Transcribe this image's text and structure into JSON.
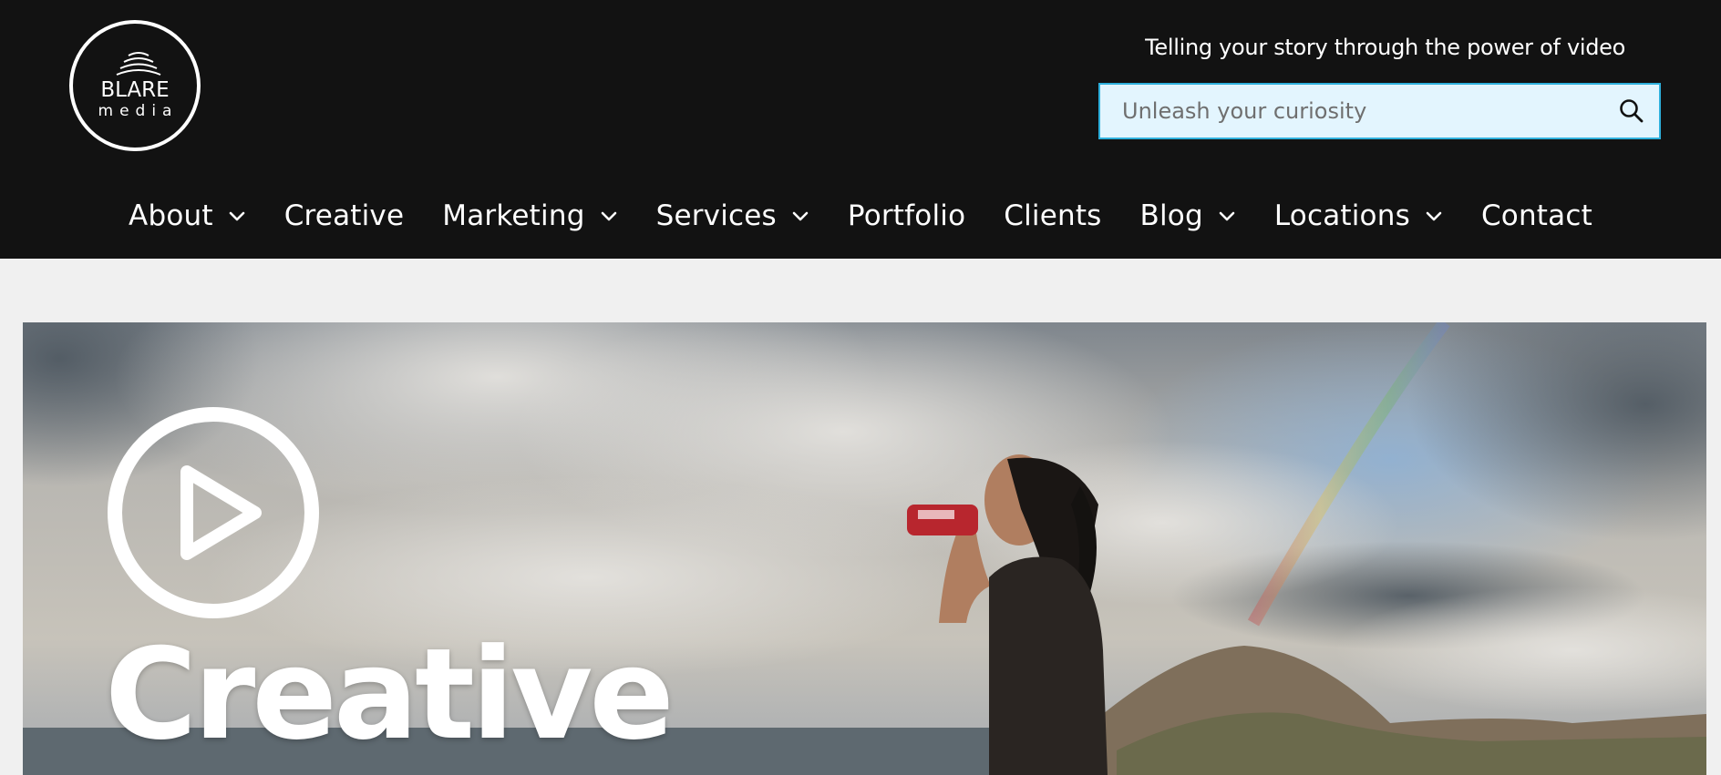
{
  "header": {
    "logo": {
      "top_text": "BLARE",
      "bottom_text": "media"
    },
    "tagline": "Telling your story through the power of video",
    "search": {
      "placeholder": "Unleash your curiosity",
      "value": "",
      "button_icon": "search-icon"
    }
  },
  "nav": {
    "items": [
      {
        "label": "About",
        "has_dropdown": true
      },
      {
        "label": "Creative",
        "has_dropdown": false
      },
      {
        "label": "Marketing",
        "has_dropdown": true
      },
      {
        "label": "Services",
        "has_dropdown": true
      },
      {
        "label": "Portfolio",
        "has_dropdown": false
      },
      {
        "label": "Clients",
        "has_dropdown": false
      },
      {
        "label": "Blog",
        "has_dropdown": true
      },
      {
        "label": "Locations",
        "has_dropdown": true
      },
      {
        "label": "Contact",
        "has_dropdown": false
      }
    ]
  },
  "hero": {
    "title": "Creative",
    "play_icon": "play-circle-icon"
  },
  "colors": {
    "header_bg": "#121212",
    "page_bg": "#f0f0f0",
    "search_bg": "#e3f5fe",
    "search_border": "#2eb0dc",
    "nav_text": "#ffffff"
  }
}
